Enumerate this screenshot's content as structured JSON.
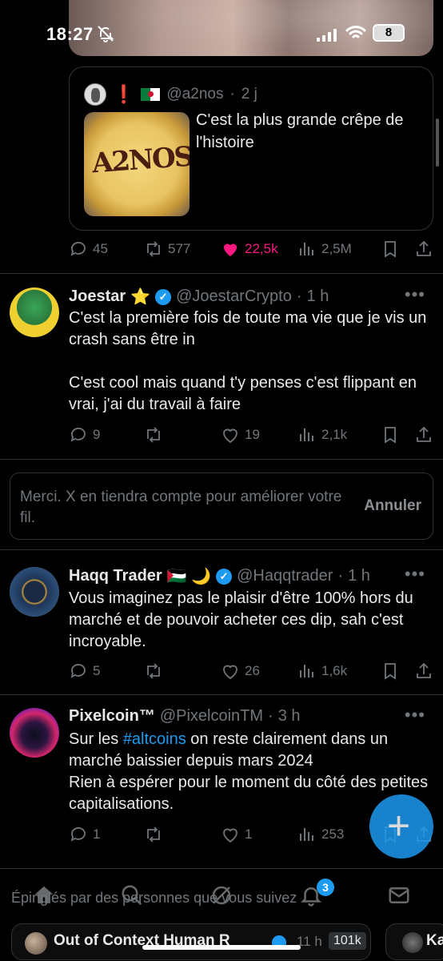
{
  "status_bar": {
    "time": "18:27",
    "battery": "8"
  },
  "quote": {
    "handle": "@a2nos",
    "time": "2 j",
    "image_text": "A2NOS",
    "text": "C'est la plus grande crêpe de l'histoire",
    "replies": "45",
    "reposts": "577",
    "likes": "22,5k",
    "views": "2,5M"
  },
  "tweets": [
    {
      "name": "Joestar",
      "name_emoji": "⭐",
      "handle": "@JoestarCrypto",
      "time": "1 h",
      "text": "C'est la première fois de toute ma vie que je vis un crash sans être in\n\nC'est cool mais quand t'y penses c'est flippant en vrai, j'ai du travail à faire",
      "replies": "9",
      "reposts": "",
      "likes": "19",
      "views": "2,1k"
    },
    {
      "name": "Haqq Trader",
      "name_emoji": "🇵🇸 🌙",
      "handle": "@Haqqtrader",
      "time": "1 h",
      "text": "Vous imaginez pas le plaisir d'être 100% hors du marché et de pouvoir acheter ces dip, sah c'est incroyable.",
      "replies": "5",
      "reposts": "",
      "likes": "26",
      "views": "1,6k"
    },
    {
      "name": "Pixelcoin™",
      "handle": "@PixelcoinTM",
      "time": "3 h",
      "text_before": "Sur les ",
      "hashtag": "#altcoins",
      "text_after": " on reste clairement dans un marché baissier depuis mars 2024\nRien à espérer pour le moment du côté des petites capitalisations.",
      "replies": "1",
      "reposts": "",
      "likes": "1",
      "views": "253"
    }
  ],
  "feedback": {
    "text": "Merci. X en tiendra compte pour améliorer votre fil.",
    "cancel": "Annuler"
  },
  "bottom": {
    "pinned_label": "Épinglés par des personnes que vous suivez",
    "notif_badge": "3",
    "pinned_title": "Out of Context Human R",
    "pinned_time": "11 h",
    "pinned_count": "101k",
    "pinned2_text": "Ka"
  },
  "icons": [
    "bell-off-icon",
    "signal-icon",
    "wifi-icon",
    "reply-icon",
    "repost-icon",
    "heart-icon",
    "views-icon",
    "bookmark-icon",
    "share-icon",
    "more-icon",
    "verified-icon",
    "home-icon",
    "search-icon",
    "grok-icon",
    "notifications-icon",
    "mail-icon",
    "compose-icon"
  ],
  "colors": {
    "accent": "#1d9bf0",
    "like": "#f91880",
    "muted": "#71767b",
    "text": "#e7e9ea",
    "background": "#000000"
  }
}
